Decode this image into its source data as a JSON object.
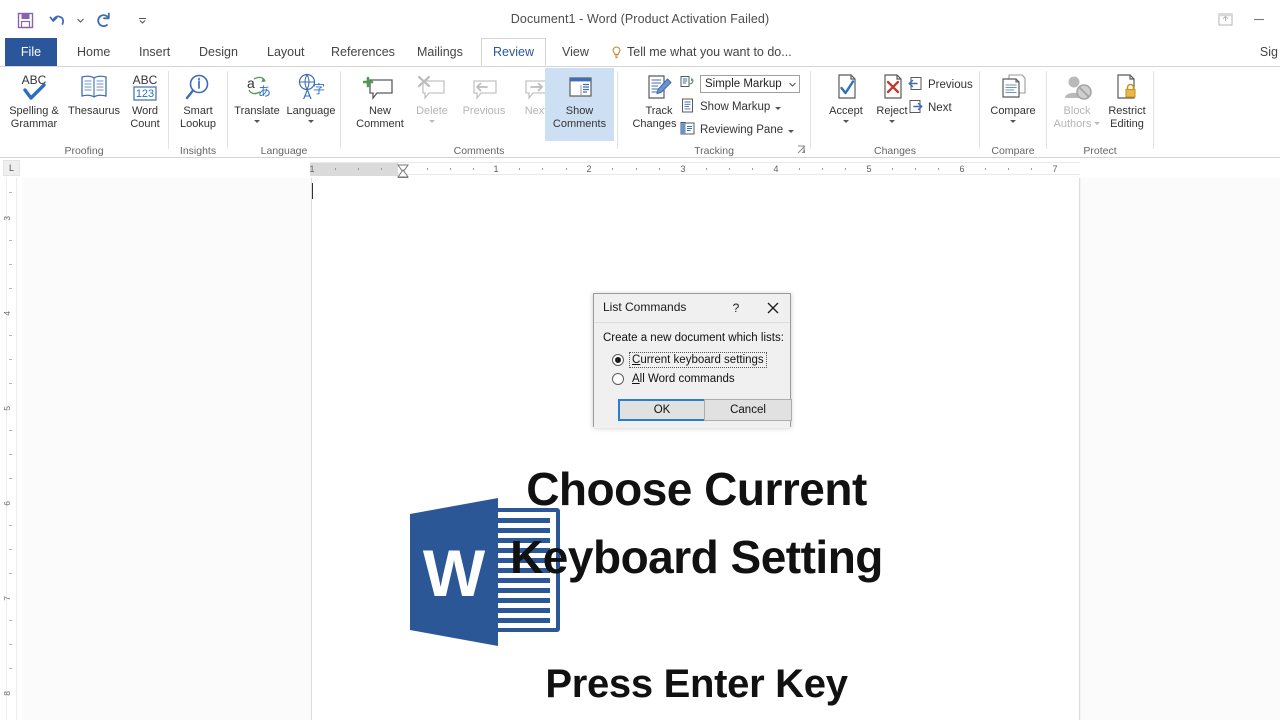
{
  "titlebar": {
    "document_title": "Document1 - Word (Product Activation Failed)",
    "quick_access": [
      {
        "name": "save",
        "icon": "save-icon"
      },
      {
        "name": "undo",
        "icon": "undo-icon"
      },
      {
        "name": "redo",
        "icon": "redo-icon"
      },
      {
        "name": "customize-quick-access-toolbar",
        "icon": "chevron-down-icon"
      }
    ],
    "ribbon_display_options": "ribbon-display-options-icon",
    "minimize": "minimize-icon"
  },
  "tabs": [
    {
      "label": "File",
      "active": false
    },
    {
      "label": "Home",
      "active": false
    },
    {
      "label": "Insert",
      "active": false
    },
    {
      "label": "Design",
      "active": false
    },
    {
      "label": "Layout",
      "active": false
    },
    {
      "label": "References",
      "active": false
    },
    {
      "label": "Mailings",
      "active": false
    },
    {
      "label": "Review",
      "active": true
    },
    {
      "label": "View",
      "active": false
    }
  ],
  "tellme": {
    "label": "Tell me what you want to do..."
  },
  "signin": {
    "label": "Sig"
  },
  "ribbon": {
    "groups": [
      {
        "name": "Proofing",
        "label": "Proofing",
        "buttons": [
          {
            "label_line1": "Spelling &",
            "label_line2": "Grammar",
            "icon": "spelling-grammar-icon",
            "disabled": false
          },
          {
            "label_line1": "Thesaurus",
            "label_line2": "",
            "icon": "thesaurus-icon",
            "disabled": false
          },
          {
            "label_line1": "Word",
            "label_line2": "Count",
            "icon": "word-count-icon",
            "disabled": false
          }
        ]
      },
      {
        "name": "Insights",
        "label": "Insights",
        "buttons": [
          {
            "label_line1": "Smart",
            "label_line2": "Lookup",
            "icon": "smart-lookup-icon",
            "disabled": false
          }
        ]
      },
      {
        "name": "Language",
        "label": "Language",
        "buttons": [
          {
            "label_line1": "Translate",
            "label_line2": "",
            "icon": "translate-icon",
            "disabled": false
          },
          {
            "label_line1": "Language",
            "label_line2": "",
            "icon": "language-icon",
            "disabled": false
          }
        ]
      },
      {
        "name": "Comments",
        "label": "Comments",
        "buttons": [
          {
            "label_line1": "New",
            "label_line2": "Comment",
            "icon": "new-comment-icon",
            "disabled": false
          },
          {
            "label_line1": "Delete",
            "label_line2": "",
            "icon": "delete-comment-icon",
            "disabled": true
          },
          {
            "label_line1": "Previous",
            "label_line2": "",
            "icon": "previous-comment-icon",
            "disabled": true
          },
          {
            "label_line1": "Next",
            "label_line2": "",
            "icon": "next-comment-icon",
            "disabled": true
          },
          {
            "label_line1": "Show",
            "label_line2": "Comments",
            "icon": "show-comments-icon",
            "disabled": false,
            "selected": true
          }
        ]
      },
      {
        "name": "Tracking",
        "label": "Tracking",
        "buttons": [
          {
            "label_line1": "Track",
            "label_line2": "Changes",
            "icon": "track-changes-icon",
            "disabled": false
          }
        ],
        "small_items": [
          {
            "label": "Simple Markup",
            "icon": "display-for-review-icon",
            "type": "combo"
          },
          {
            "label": "Show Markup",
            "icon": "show-markup-icon",
            "type": "menu"
          },
          {
            "label": "Reviewing Pane",
            "icon": "reviewing-pane-icon",
            "type": "menu"
          }
        ]
      },
      {
        "name": "Changes",
        "label": "Changes",
        "buttons": [
          {
            "label_line1": "Accept",
            "label_line2": "",
            "icon": "accept-icon",
            "disabled": false
          },
          {
            "label_line1": "Reject",
            "label_line2": "",
            "icon": "reject-icon",
            "disabled": false
          }
        ],
        "small_items": [
          {
            "label": "Previous",
            "icon": "previous-change-icon",
            "type": "button"
          },
          {
            "label": "Next",
            "icon": "next-change-icon",
            "type": "button"
          }
        ]
      },
      {
        "name": "Compare",
        "label": "Compare",
        "buttons": [
          {
            "label_line1": "Compare",
            "label_line2": "",
            "icon": "compare-icon",
            "disabled": false
          }
        ]
      },
      {
        "name": "Protect",
        "label": "Protect",
        "buttons": [
          {
            "label_line1": "Block",
            "label_line2": "Authors",
            "icon": "block-authors-icon",
            "disabled": true
          },
          {
            "label_line1": "Restrict",
            "label_line2": "Editing",
            "icon": "restrict-editing-icon",
            "disabled": false
          }
        ]
      }
    ]
  },
  "rulers": {
    "corner_label": "L",
    "horizontal_numbers": [
      "1",
      "1",
      "2",
      "3",
      "4",
      "5",
      "6",
      "7"
    ],
    "vertical_numbers": [
      "3",
      "4",
      "5",
      "6",
      "7",
      "8"
    ]
  },
  "document": {
    "logo": "word-logo",
    "line1": "Choose Current",
    "line2": "Keyboard Setting",
    "line3": "Press Enter Key"
  },
  "dialog": {
    "title": "List Commands",
    "help_glyph": "?",
    "close_glyph": "close-icon",
    "prompt": "Create a new document which lists:",
    "options": [
      {
        "label": "Current keyboard settings",
        "accel": "C",
        "selected": true,
        "focused": true
      },
      {
        "label": "All Word commands",
        "accel": "A",
        "selected": false,
        "focused": false
      }
    ],
    "ok_label": "OK",
    "cancel_label": "Cancel"
  },
  "colors": {
    "file_tab_blue": "#2b579a",
    "active_tab_text": "#2b579a",
    "selected_button_bg": "#cde0f3",
    "logo_blue": "#2b5797",
    "default_button_border": "#2b7cd3"
  }
}
